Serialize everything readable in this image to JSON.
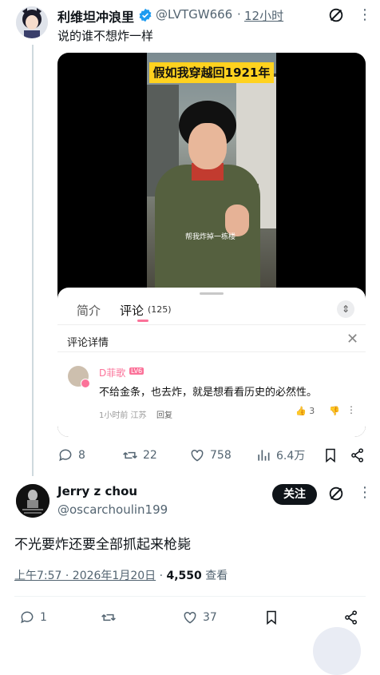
{
  "tweet1": {
    "author_name": "利维坦冲浪里",
    "handle": "@LVTGW666",
    "separator": "·",
    "time": "12小时",
    "text": "说的谁不想炸一样",
    "video": {
      "title": "假如我穿越回1921年",
      "subtitle": "帮我炸掉一栋楼"
    },
    "comment_panel": {
      "tab_intro": "简介",
      "tab_comments": "评论",
      "comment_count": "(125)",
      "collapse_icon": "chevron-updown-icon",
      "detail_title": "评论详情",
      "close_icon": "close-icon",
      "comment": {
        "username": "D菲歌",
        "level": "LV6",
        "text": "不给金条，也去炸，就是想看看历史的必然性。",
        "meta": "1小时前 江苏",
        "reply": "回复",
        "likes": "3"
      }
    },
    "actions": {
      "replies": "8",
      "retweets": "22",
      "likes": "758",
      "views": "6.4万"
    }
  },
  "tweet2": {
    "author_name": "Jerry z chou",
    "handle": "@oscarchoulin199",
    "follow_label": "关注",
    "text": "不光要炸还要全部抓起来枪毙",
    "timestamp": "上午7:57 · 2026年1月20日",
    "separator": "·",
    "views": "4,550",
    "views_label": "查看",
    "actions": {
      "replies": "1",
      "likes": "37"
    }
  },
  "colors": {
    "verified": "#1d9bf0",
    "video_title_bg": "#ffd21f",
    "bilibili_pink": "#fb7299",
    "follow_button": "#0f1419"
  }
}
